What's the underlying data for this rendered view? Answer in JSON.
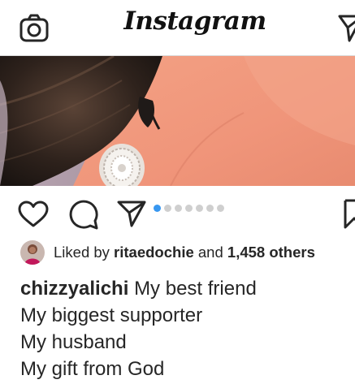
{
  "header": {
    "title": "Instagram",
    "camera_icon": "camera-icon",
    "direct_icon": "direct-message-icon"
  },
  "actions": {
    "like_icon": "heart-icon",
    "comment_icon": "comment-icon",
    "share_icon": "paper-plane-icon",
    "save_icon": "bookmark-icon",
    "carousel_total": 7,
    "carousel_active_index": 0,
    "accent_color": "#3897f0"
  },
  "likes": {
    "prefix": "Liked by",
    "user": "ritaedochie",
    "and": "and",
    "count": "1,458 others"
  },
  "caption": {
    "username": "chizzyalichi",
    "line1": "My best friend",
    "line2": "My biggest supporter",
    "line3": "My husband",
    "line4": "My gift from God"
  }
}
